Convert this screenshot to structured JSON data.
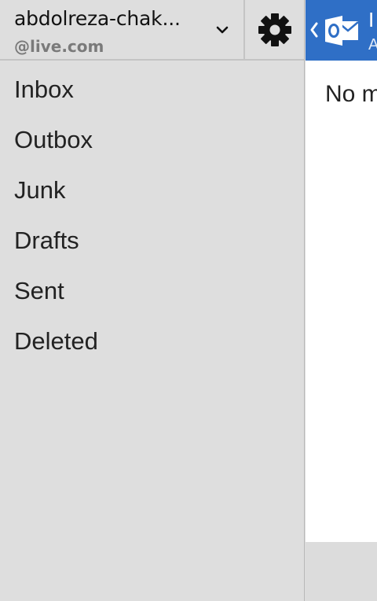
{
  "account": {
    "name": "abdolreza-chak...",
    "domain": "@live.com"
  },
  "icons": {
    "account_menu": "chevron-down-icon",
    "settings": "gear-icon",
    "back": "chevron-left-icon",
    "app_logo": "outlook-logo-icon"
  },
  "folders": [
    {
      "label": "Inbox"
    },
    {
      "label": "Outbox"
    },
    {
      "label": "Junk"
    },
    {
      "label": "Drafts"
    },
    {
      "label": "Sent"
    },
    {
      "label": "Deleted"
    }
  ],
  "message_pane": {
    "title": "I",
    "subtitle": "A",
    "empty_text": "No m"
  },
  "colors": {
    "accent": "#2f6fc6",
    "pane_background": "#dedede",
    "content_background": "#ffffff"
  }
}
